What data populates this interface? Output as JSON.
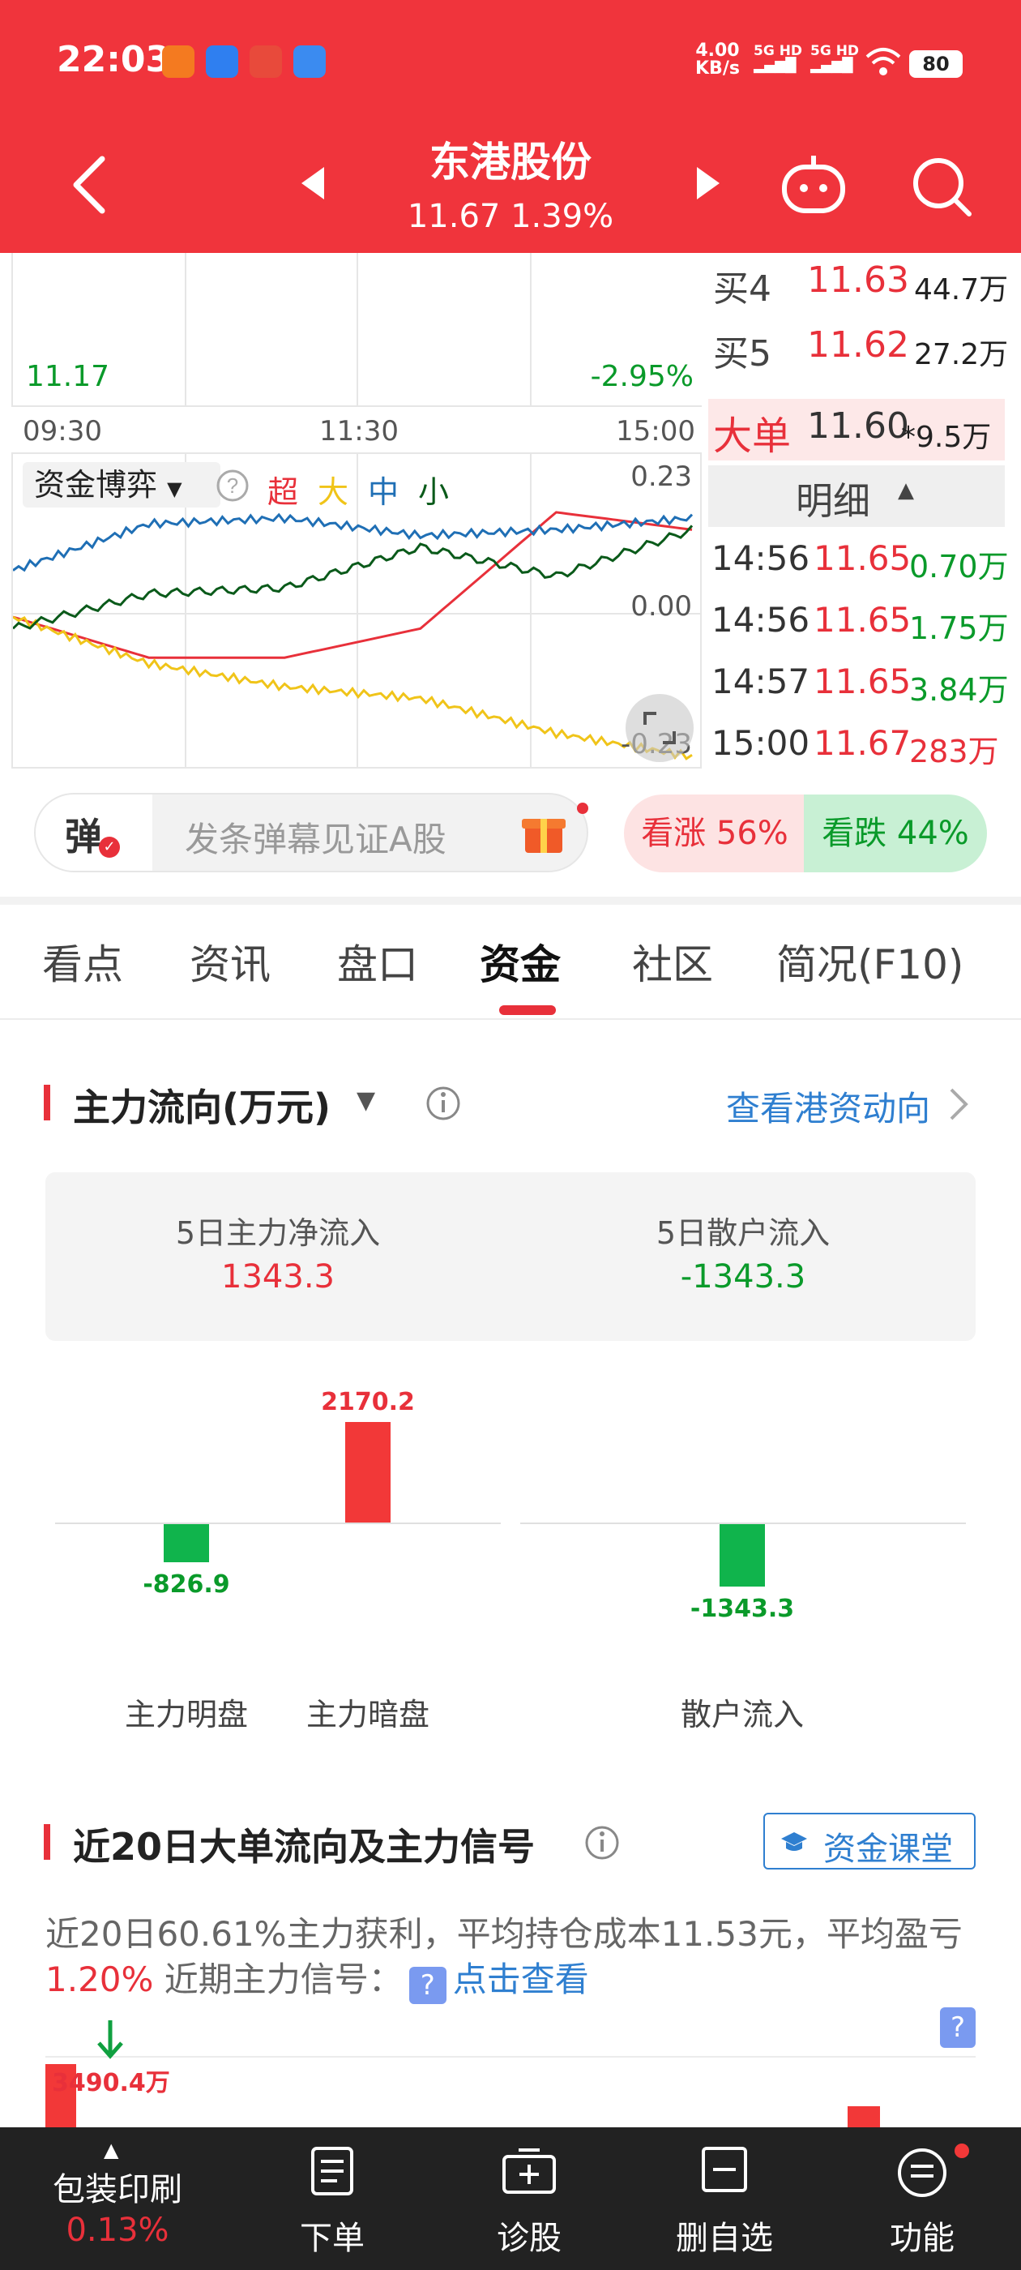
{
  "status_bar": {
    "time": "22:03",
    "net_speed_value": "4.00",
    "net_speed_unit": "KB/s",
    "sim1": "5G HD",
    "sim2": "5G HD",
    "battery": "80"
  },
  "header": {
    "stock_name": "东港股份",
    "price_line": "11.67 1.39%"
  },
  "intraday_chart": {
    "low_price": "11.17",
    "low_pct": "-2.95%",
    "time_axis": [
      "09:30",
      "11:30",
      "15:00"
    ],
    "panel_selector": "资金博弈",
    "legend": [
      "超",
      "大",
      "中",
      "小"
    ],
    "upper_value": "0.23",
    "mid_value": "0.00",
    "lower_value": "-0.23"
  },
  "chart_data": {
    "type": "line",
    "title": "资金博弈",
    "x": [
      "09:30",
      "11:30",
      "15:00"
    ],
    "ylim": [
      -0.23,
      0.23
    ],
    "series": [
      {
        "name": "超",
        "color": "#e8303a",
        "values": [
          0.0,
          -0.07,
          -0.07,
          -0.02,
          0.18,
          0.15
        ]
      },
      {
        "name": "大",
        "color": "#f0c419",
        "values": [
          0.0,
          -0.08,
          -0.12,
          -0.14,
          -0.2,
          -0.24
        ]
      },
      {
        "name": "中",
        "color": "#1f6fb5",
        "values": [
          0.08,
          0.16,
          0.17,
          0.14,
          0.15,
          0.17
        ]
      },
      {
        "name": "小",
        "color": "#0a5a1a",
        "values": [
          -0.02,
          0.04,
          0.05,
          0.12,
          0.07,
          0.15
        ]
      }
    ]
  },
  "order_book": {
    "rows": [
      {
        "label": "买4",
        "price": "11.63",
        "vol": "44.7万"
      },
      {
        "label": "买5",
        "price": "11.62",
        "vol": "27.2万"
      }
    ],
    "big_order_label": "大单",
    "big_order_price": "11.60",
    "big_order_vol": "*9.5万",
    "detail_label": "明细",
    "ticks": [
      {
        "time": "14:56",
        "price": "11.65",
        "vol": "0.70万",
        "color": "green"
      },
      {
        "time": "14:56",
        "price": "11.65",
        "vol": "1.75万",
        "color": "green"
      },
      {
        "time": "14:57",
        "price": "11.65",
        "vol": "3.84万",
        "color": "green"
      },
      {
        "time": "15:00",
        "price": "11.67",
        "vol": "283万",
        "color": "red"
      }
    ]
  },
  "danmaku": {
    "icon_text": "弹",
    "placeholder": "发条弹幕见证A股",
    "bull": "看涨 56%",
    "bear": "看跌 44%"
  },
  "tabs": [
    "看点",
    "资讯",
    "盘口",
    "资金",
    "社区",
    "简况(F10)"
  ],
  "active_tab": 3,
  "main_flow": {
    "title": "主力流向(万元)",
    "link": "查看港资动向",
    "net5_label": "5日主力净流入",
    "net5_value": "1343.3",
    "retail5_label": "5日散户流入",
    "retail5_value": "-1343.3",
    "bars": [
      {
        "label": "主力明盘",
        "value": -826.9,
        "text": "-826.9"
      },
      {
        "label": "主力暗盘",
        "value": 2170.2,
        "text": "2170.2"
      },
      {
        "label": "散户流入",
        "value": -1343.3,
        "text": "-1343.3"
      }
    ]
  },
  "signal": {
    "title": "近20日大单流向及主力信号",
    "class_button": "资金课堂",
    "desc_prefix": "近20日60.61%主力获利，平均持仓成本11.53元，平均盈亏",
    "desc_pct": "1.20%",
    "desc_mid": " 近期主力信号：",
    "desc_link": "点击查看",
    "first_bar_label": "3490.4万"
  },
  "bottom_nav": {
    "stock_name": "包装印刷",
    "stock_pct": "0.13%",
    "items": [
      "下单",
      "诊股",
      "删自选",
      "功能"
    ]
  }
}
